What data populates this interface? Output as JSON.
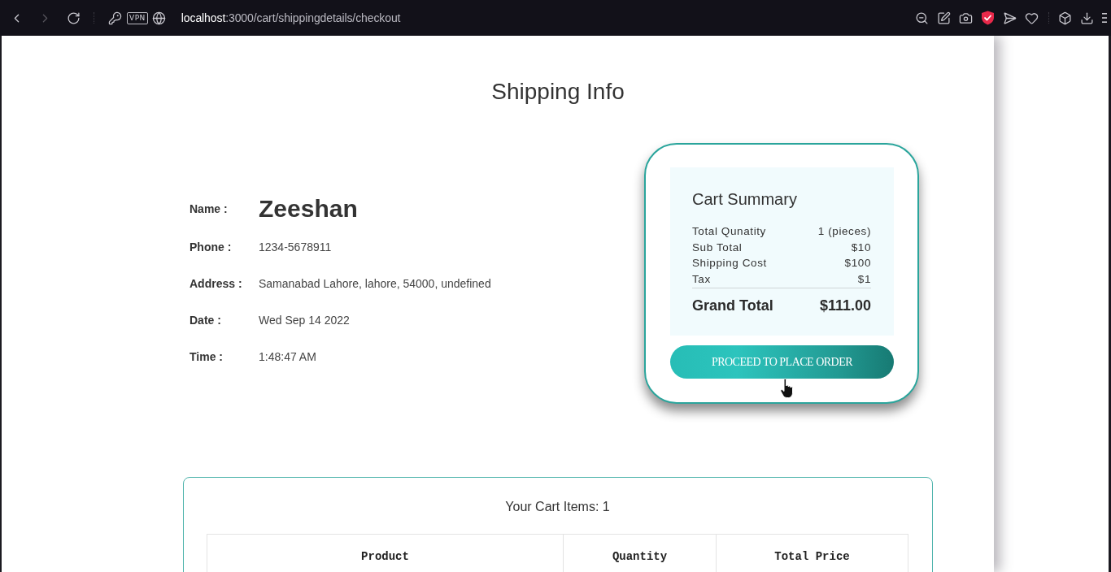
{
  "browser": {
    "forward_disabled": true,
    "vpn_label": "VPN",
    "address": {
      "host": "localhost",
      "path": ":3000/cart/shippingdetails/checkout"
    }
  },
  "page": {
    "title": "Shipping Info",
    "details": [
      {
        "kind": "name",
        "label": "Name :",
        "value": "Zeeshan"
      },
      {
        "kind": "text",
        "label": "Phone :",
        "value": "1234-5678911"
      },
      {
        "kind": "text",
        "label": "Address :",
        "value": "Samanabad Lahore, lahore, 54000, undefined"
      },
      {
        "kind": "text",
        "label": "Date :",
        "value": "Wed Sep 14 2022"
      },
      {
        "kind": "text",
        "label": "Time :",
        "value": "1:48:47 AM"
      }
    ]
  },
  "cart_summary": {
    "title": "Cart Summary",
    "rows": [
      {
        "label": "Total Qunatity",
        "value": "1 (pieces)"
      },
      {
        "label": "Sub Total",
        "value": "$10"
      },
      {
        "label": "Shipping Cost",
        "value": "$100"
      },
      {
        "label": "Tax",
        "value": "$1"
      }
    ],
    "total": {
      "label": "Grand Total",
      "value": "$111.00"
    },
    "button": "PROCEED TO PLACE ORDER"
  },
  "cart_items": {
    "heading": "Your Cart Items: 1",
    "columns": [
      "Product",
      "Quantity",
      "Total Price"
    ]
  }
}
